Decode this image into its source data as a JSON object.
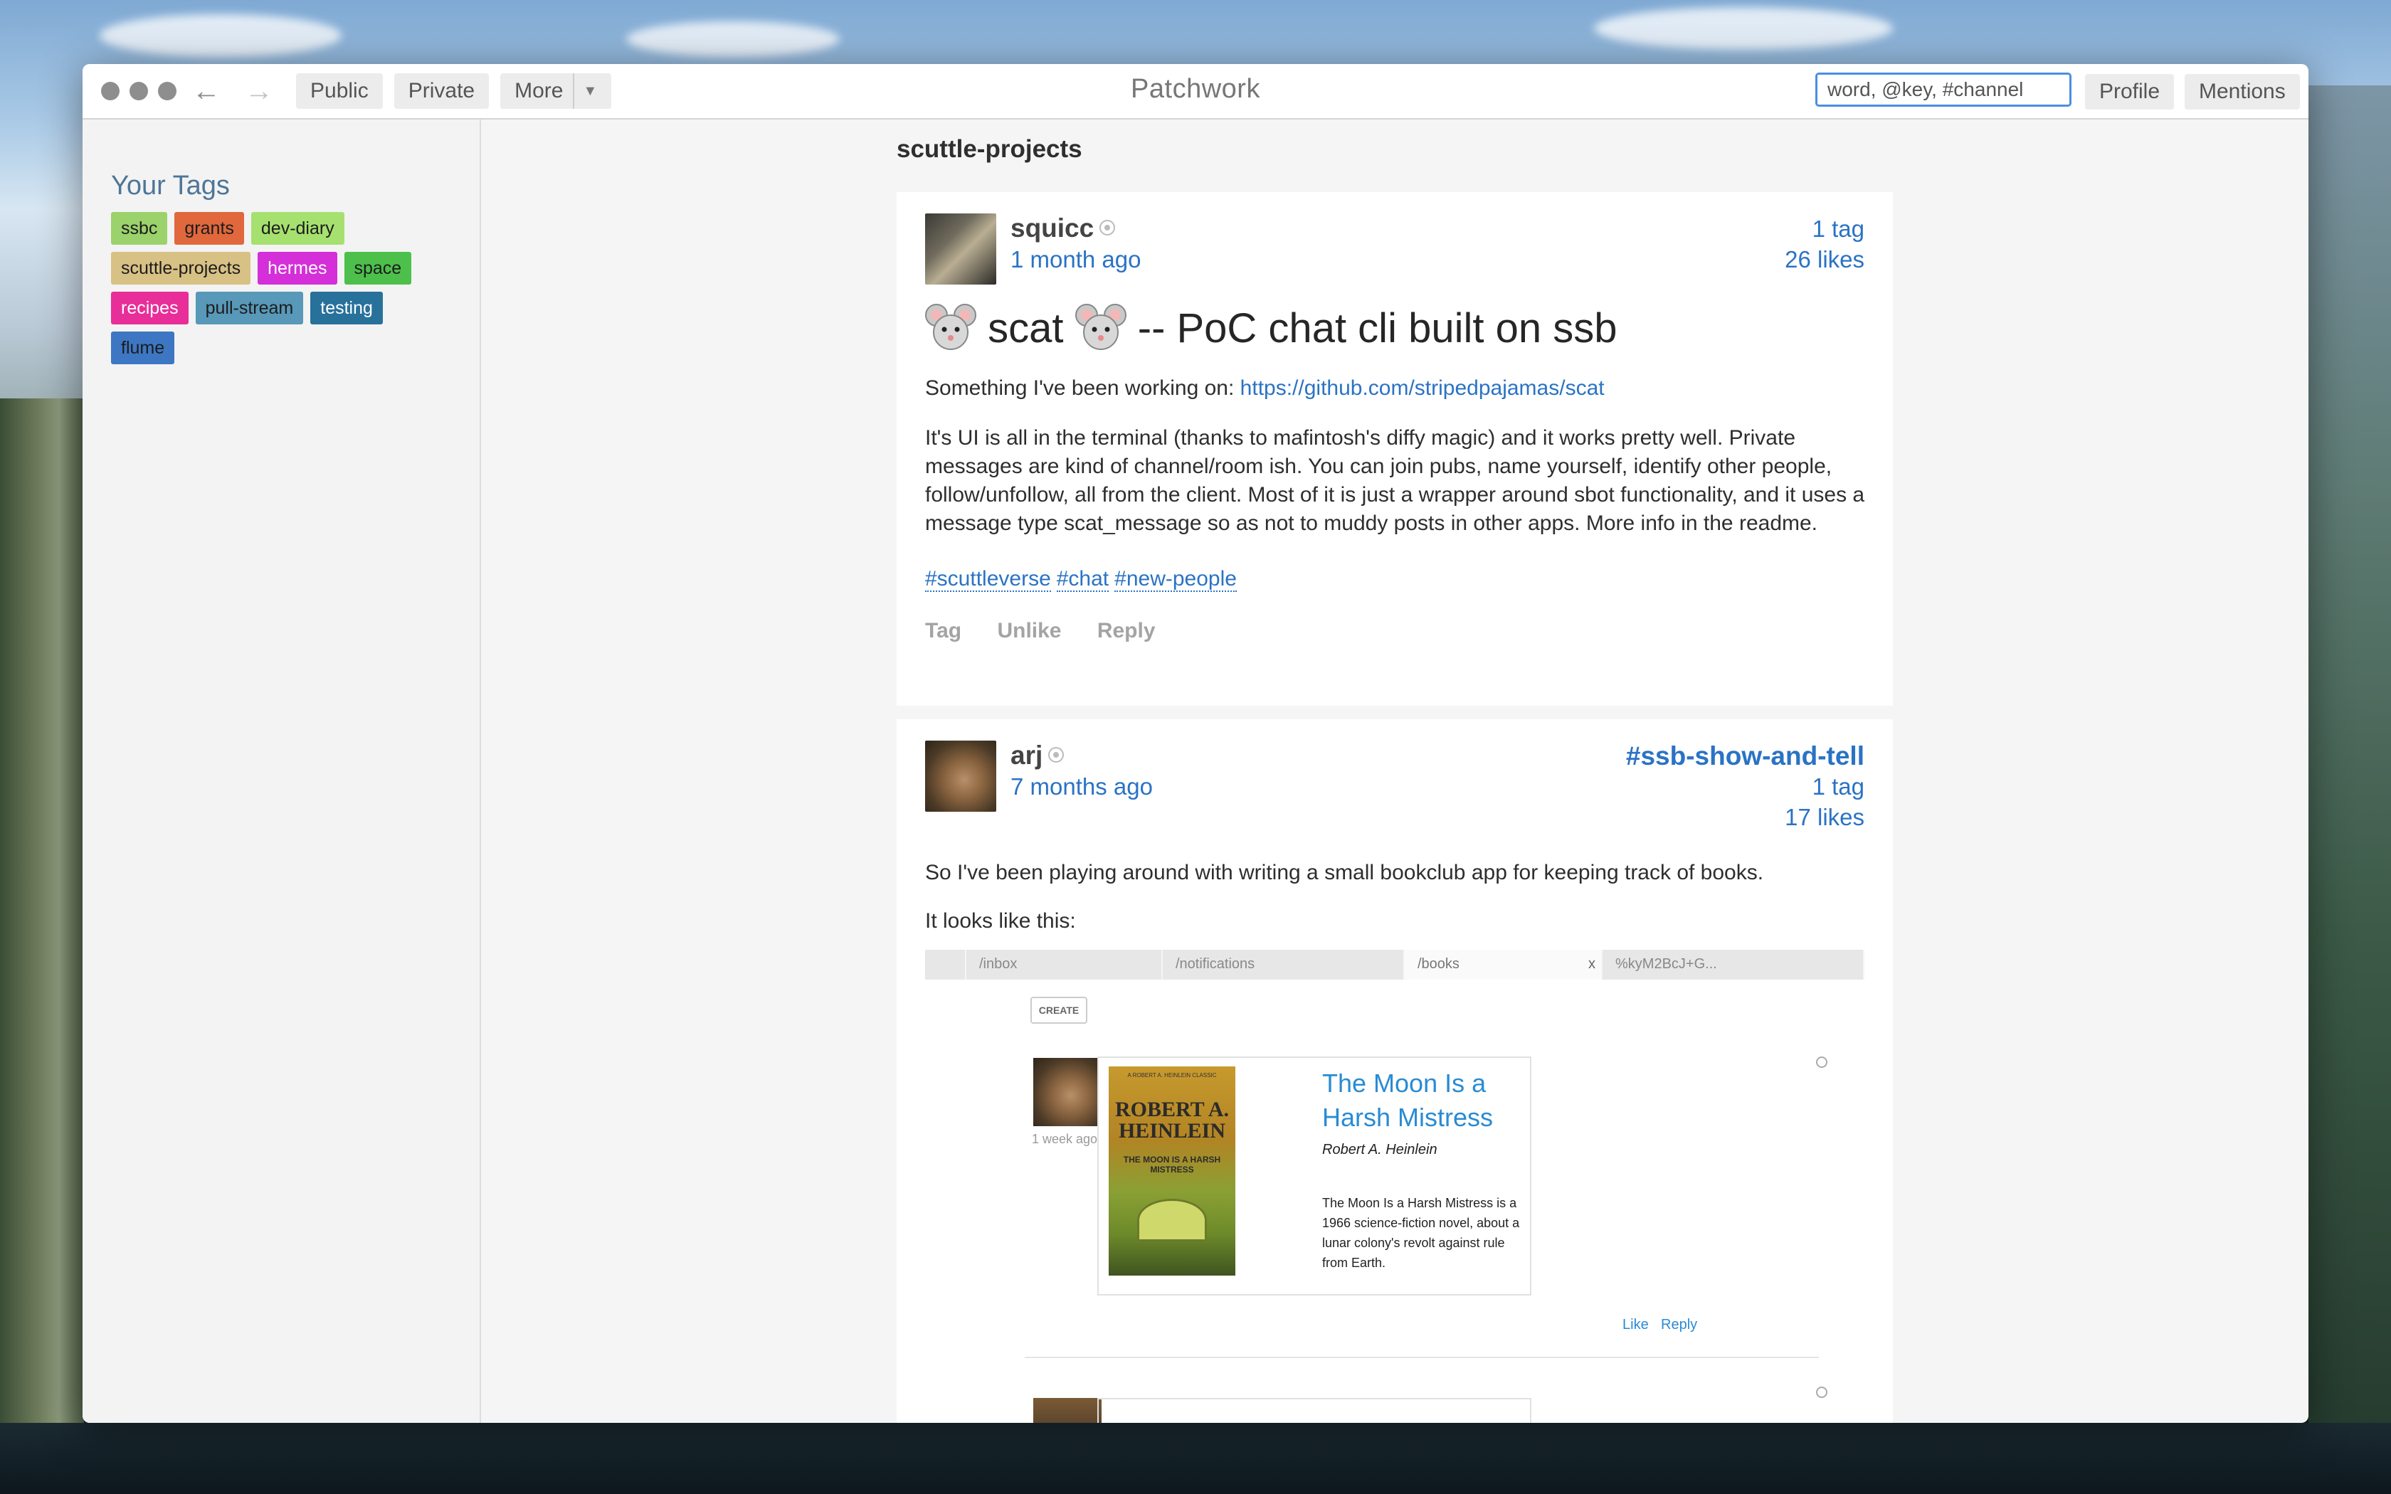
{
  "window": {
    "title": "Patchwork",
    "nav": {
      "public": "Public",
      "private": "Private",
      "more": "More"
    },
    "search_placeholder": "word, @key, #channel",
    "profile": "Profile",
    "mentions": "Mentions"
  },
  "sidebar": {
    "heading": "Your Tags",
    "tags": [
      {
        "label": "ssbc",
        "color": "#9bd26b"
      },
      {
        "label": "grants",
        "color": "#e0683c"
      },
      {
        "label": "dev-diary",
        "color": "#a6e16f"
      },
      {
        "label": "scuttle-projects",
        "color": "#d8c184"
      },
      {
        "label": "hermes",
        "color": "#d42fd8"
      },
      {
        "label": "space",
        "color": "#4dc04c"
      },
      {
        "label": "recipes",
        "color": "#e82e98"
      },
      {
        "label": "pull-stream",
        "color": "#5898b8"
      },
      {
        "label": "testing",
        "color": "#27719b"
      },
      {
        "label": "flume",
        "color": "#3d77c4"
      }
    ]
  },
  "main": {
    "channel_title": "scuttle-projects",
    "posts": [
      {
        "author": "squicc",
        "ago": "1 month ago",
        "tags_count": "1 tag",
        "likes": "26 likes",
        "title": "scat",
        "title_tail": "-- PoC chat cli built on ssb",
        "intro": "Something I've been working on: ",
        "link": "https://github.com/stripedpajamas/scat",
        "body": "It's UI is all in the terminal (thanks to mafintosh's diffy magic) and it works pretty well. Private messages are kind of channel/room ish. You can join pubs, name yourself, identify other people, follow/unfollow, all from the client. Most of it is just a wrapper around sbot functionality, and it uses a message type scat_message so as not to muddy posts in other apps. More info in the readme.",
        "hashtags": [
          "#scuttleverse",
          "#chat",
          "#new-people"
        ],
        "actions": {
          "tag": "Tag",
          "like": "Unlike",
          "reply": "Reply"
        }
      },
      {
        "author": "arj",
        "ago": "7 months ago",
        "channel": "#ssb-show-and-tell",
        "tags_count": "1 tag",
        "likes": "17 likes",
        "body1": "So I've been playing around with writing a small bookclub app for keeping track of books.",
        "body2": "It looks like this:",
        "embedded": {
          "tabs": [
            "/inbox",
            "/notifications",
            "/books",
            "%kyM2BcJ+G..."
          ],
          "close": "x",
          "create": "CREATE",
          "ago": "1 week ago",
          "cover_top": "A ROBERT A. HEINLEIN CLASSIC",
          "cover_author": "ROBERT A. HEINLEIN",
          "cover_title": "THE MOON IS A HARSH MISTRESS",
          "book_title": "The Moon Is a Harsh Mistress",
          "book_author": "Robert A. Heinlein",
          "book_desc": "The Moon Is a Harsh Mistress is a 1966 science-fiction novel, about a lunar colony's revolt against rule from Earth.",
          "like": "Like",
          "reply": "Reply"
        }
      }
    ]
  }
}
